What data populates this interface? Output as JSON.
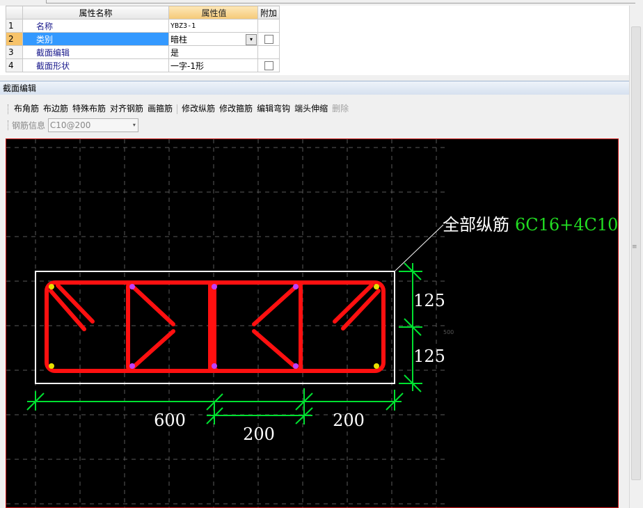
{
  "property_grid": {
    "headers": {
      "name": "属性名称",
      "value": "属性值",
      "extra": "附加"
    },
    "rows": [
      {
        "num": "1",
        "name": "名称",
        "value": "YBZ3-1"
      },
      {
        "num": "2",
        "name": "类别",
        "value": "暗柱"
      },
      {
        "num": "3",
        "name": "截面编辑",
        "value": "是"
      },
      {
        "num": "4",
        "name": "截面形状",
        "value": "一字-1形"
      }
    ],
    "dropdown_arrow": "▾"
  },
  "section_editor": {
    "title": "截面编辑",
    "toolbar": [
      {
        "label": "布角筋",
        "enabled": true
      },
      {
        "label": "布边筋",
        "enabled": true
      },
      {
        "label": "特殊布筋",
        "enabled": true
      },
      {
        "label": "对齐钢筋",
        "enabled": true
      },
      {
        "label": "画箍筋",
        "enabled": true
      },
      {
        "label": "修改纵筋",
        "enabled": true
      },
      {
        "label": "修改箍筋",
        "enabled": true
      },
      {
        "label": "编辑弯钩",
        "enabled": true
      },
      {
        "label": "端头伸缩",
        "enabled": true
      },
      {
        "label": "删除",
        "enabled": false
      }
    ],
    "rebar_info_label": "钢筋信息",
    "rebar_info_value": "C10@200"
  },
  "drawing": {
    "annotation_label": "全部纵筋",
    "annotation_value": "6C16+4C10",
    "dim_widths": [
      "600",
      "200",
      "200"
    ],
    "dim_heights": [
      "125",
      "125"
    ],
    "small_dim": "500",
    "colors": {
      "background": "#000000",
      "rebar": "#ff1010",
      "dimension": "#00e030",
      "outline": "#ffffff",
      "annotation_value": "#22dd22"
    }
  }
}
